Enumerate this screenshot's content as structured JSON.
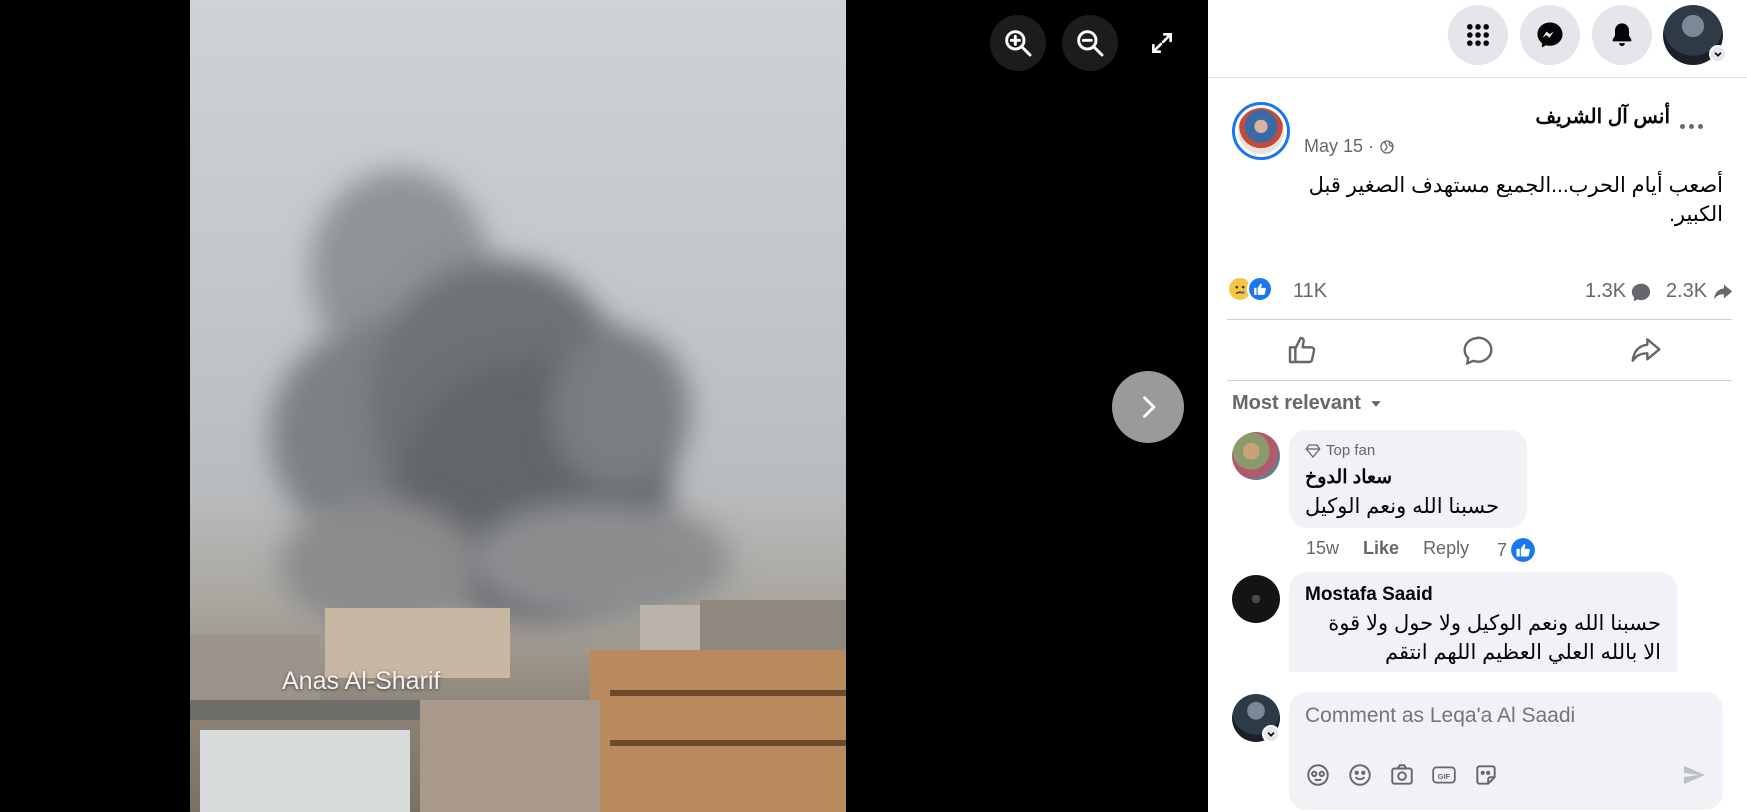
{
  "viewer": {
    "watermark": "Anas Al-Sharif",
    "controls": {
      "zoom_in_icon": "zoom-in-icon",
      "zoom_out_icon": "zoom-out-icon",
      "fullscreen_icon": "fullscreen-icon",
      "next_icon": "chevron-right-icon"
    }
  },
  "topbar": {
    "menu_icon": "grid-menu-icon",
    "messenger_icon": "messenger-icon",
    "notifications_icon": "bell-icon"
  },
  "post": {
    "author": "أنس آل الشريف",
    "date": "May 15",
    "separator": "·",
    "text": "أصعب أيام الحرب...الجميع مستهدف الصغير قبل الكبير.",
    "reactions_count": "11K",
    "comments_count": "1.3K",
    "shares_count": "2.3K"
  },
  "comments_section": {
    "sort_label": "Most relevant",
    "comments": [
      {
        "badge": "Top fan",
        "name": "سعاد الدوخ",
        "text": "حسبنا الله ونعم الوكيل",
        "time": "15w",
        "like_label": "Like",
        "reply_label": "Reply",
        "likes": "7"
      },
      {
        "name": "Mostafa Saaid",
        "text": "حسبنا الله ونعم الوكيل ولا حول ولا قوة الا بالله العلي العظيم اللهم انتقم"
      }
    ],
    "composer_placeholder": "Comment as Leqa'a Al Saadi"
  },
  "colors": {
    "accent": "#1877f2",
    "text": "#050505",
    "secondary": "#65676b",
    "surface": "#f0f2f5"
  }
}
